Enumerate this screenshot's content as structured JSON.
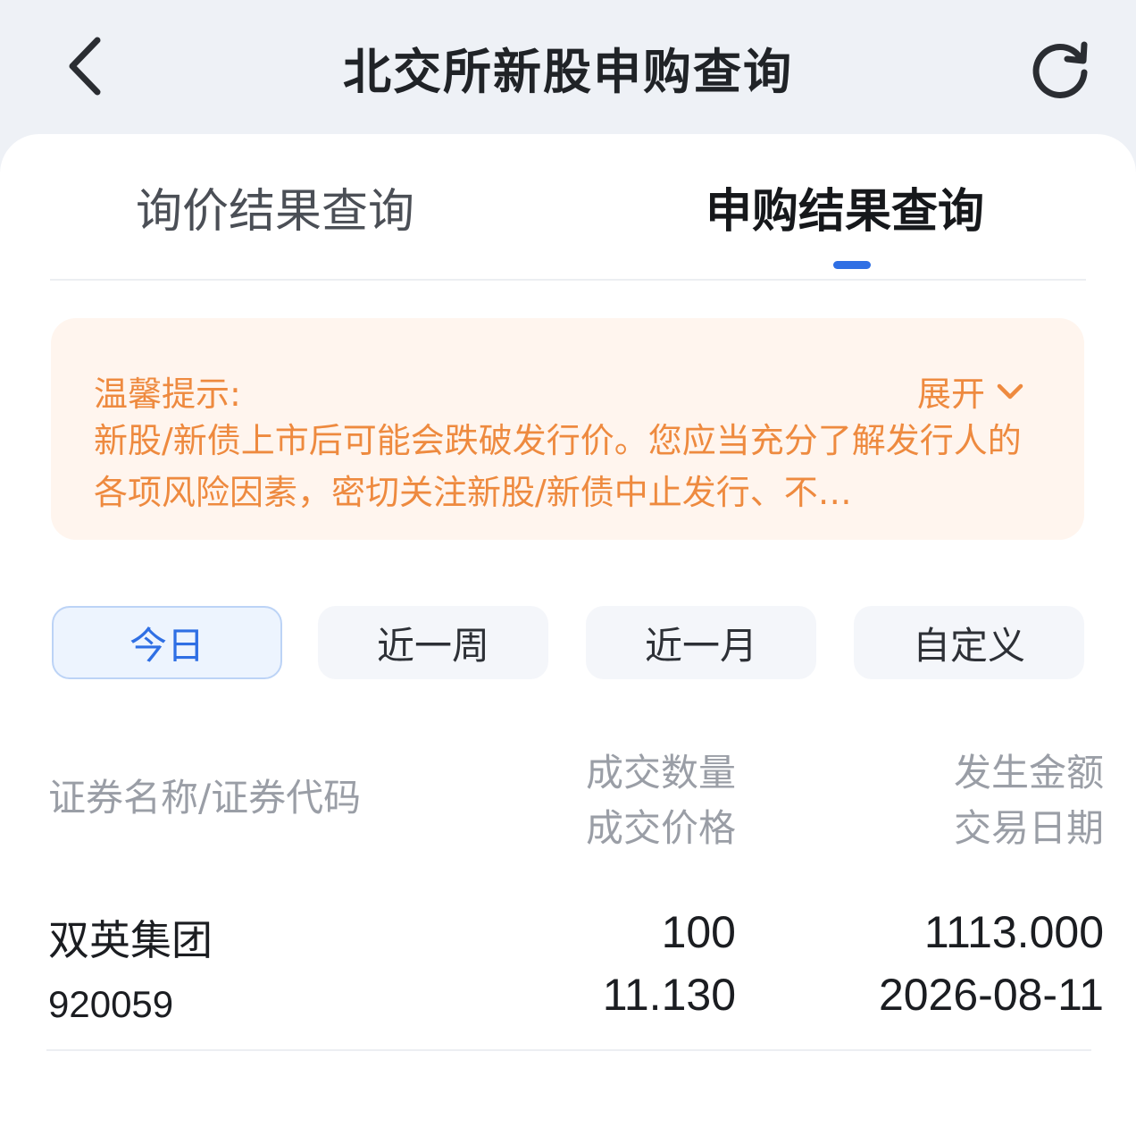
{
  "header": {
    "title": "北交所新股申购查询",
    "back_icon": "chevron-left-icon",
    "refresh_icon": "refresh-icon"
  },
  "tabs": [
    {
      "label": "询价结果查询",
      "active": false
    },
    {
      "label": "申购结果查询",
      "active": true
    }
  ],
  "notice": {
    "title": "温馨提示:",
    "expand_label": "展开",
    "expand_icon": "chevron-down-icon",
    "body": "新股/新债上市后可能会跌破发行价。您应当充分了解发行人的各项风险因素，密切关注新股/新债中止发行、不…"
  },
  "filters": [
    {
      "label": "今日",
      "active": true
    },
    {
      "label": "近一周",
      "active": false
    },
    {
      "label": "近一月",
      "active": false
    },
    {
      "label": "自定义",
      "active": false
    }
  ],
  "columns": {
    "name_code": "证券名称/证券代码",
    "qty": "成交数量",
    "price": "成交价格",
    "amount": "发生金额",
    "date": "交易日期"
  },
  "rows": [
    {
      "name": "双英集团",
      "code": "920059",
      "qty": "100",
      "price": "11.130",
      "amount": "1113.000",
      "date": "2026-08-11"
    }
  ],
  "colors": {
    "accent": "#2f6fe4",
    "notice_text": "#ee8a3f",
    "notice_bg": "#fff5ee"
  }
}
